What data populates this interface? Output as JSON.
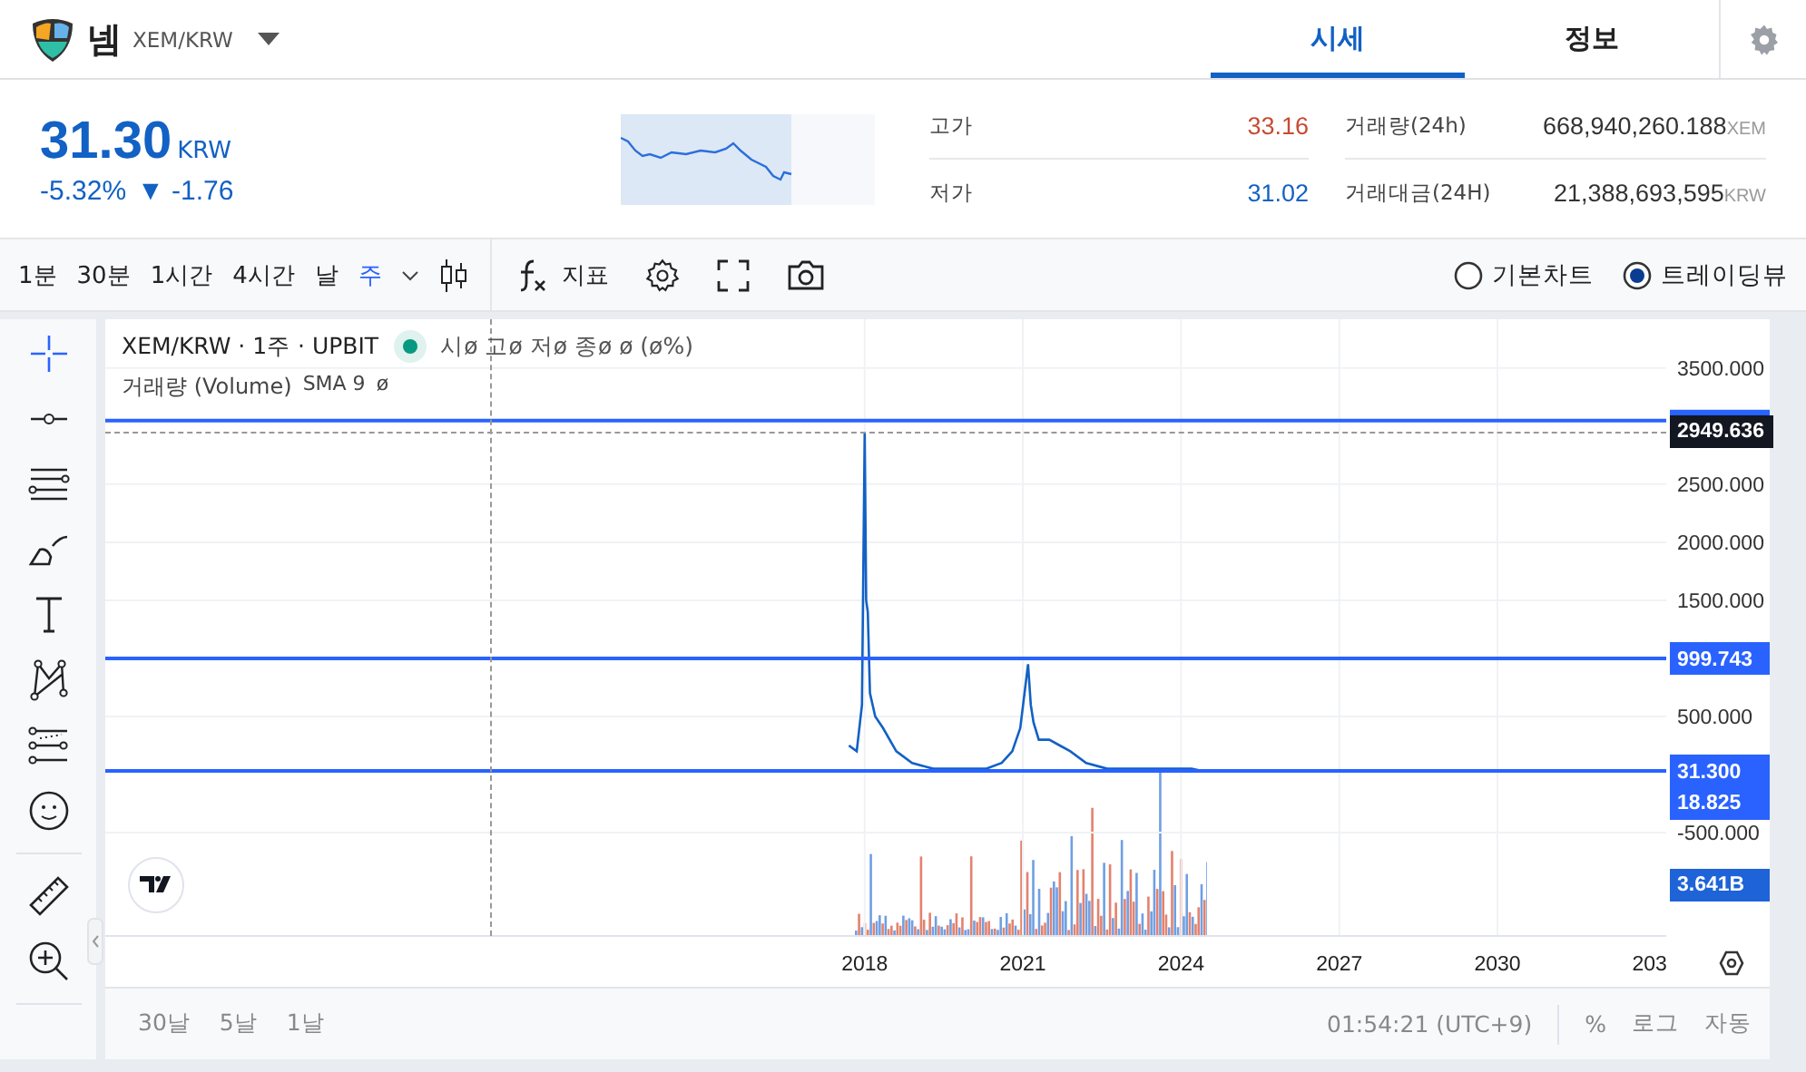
{
  "header": {
    "coin_name": "넴",
    "pair": "XEM/KRW",
    "tabs": [
      {
        "label": "시세",
        "selected": true
      },
      {
        "label": "정보",
        "selected": false
      }
    ]
  },
  "price": {
    "value": "31.30",
    "unit": "KRW",
    "color": "#1261c4",
    "change_percent": "-5.32%",
    "arrow": "▼",
    "change": "-1.76"
  },
  "stats": [
    {
      "label": "고가",
      "value": "33.16",
      "color": "#c84a31"
    },
    {
      "label": "저가",
      "value": "31.02",
      "color": "#1261c4"
    },
    {
      "label": "거래량(24h)",
      "value": "668,940,260.188",
      "unit": "XEM"
    },
    {
      "label": "거래대금(24H)",
      "value": "21,388,693,595",
      "unit": "KRW"
    }
  ],
  "toolbar": {
    "intervals": [
      {
        "label": "1분",
        "selected": false
      },
      {
        "label": "30분",
        "selected": false
      },
      {
        "label": "1시간",
        "selected": false
      },
      {
        "label": "4시간",
        "selected": false
      },
      {
        "label": "날",
        "selected": false
      },
      {
        "label": "주",
        "selected": true
      }
    ],
    "indicators_label": "지표",
    "chart_types": [
      {
        "label": "기본차트",
        "selected": false
      },
      {
        "label": "트레이딩뷰",
        "selected": true
      }
    ]
  },
  "tools": [
    {
      "kind": "crosshair",
      "selected": true
    },
    {
      "kind": "trendline",
      "selected": false
    },
    {
      "kind": "lines",
      "selected": false
    },
    {
      "kind": "brush",
      "selected": false
    },
    {
      "kind": "text",
      "selected": false
    },
    {
      "kind": "pattern",
      "selected": false
    },
    {
      "kind": "forecast",
      "selected": false
    },
    {
      "kind": "emoji",
      "selected": false
    },
    {
      "kind": "ruler",
      "selected": false
    },
    {
      "kind": "zoom",
      "selected": false
    }
  ],
  "legend": {
    "title": "XEM/KRW · 1주 · UPBIT",
    "ohlc": "시ø 고ø 저ø 종ø ø (ø%)",
    "volume_label": "거래량 (Volume)",
    "sma": "SMA 9",
    "sma_value": "ø"
  },
  "chart": {
    "chart_data": {
      "type": "line",
      "x": [
        2017.7,
        2017.85,
        2017.95,
        2018.0,
        2018.03,
        2018.06,
        2018.1,
        2018.2,
        2018.35,
        2018.6,
        2018.9,
        2019.3,
        2019.8,
        2020.3,
        2020.6,
        2020.8,
        2020.95,
        2021.1,
        2021.15,
        2021.2,
        2021.3,
        2021.5,
        2021.7,
        2021.9,
        2022.2,
        2022.6,
        2023.0,
        2023.5,
        2024.0,
        2024.2,
        2024.4
      ],
      "series": [
        {
          "color": "#1261c4",
          "values": [
            250,
            200,
            600,
            2950,
            1500,
            1400,
            700,
            500,
            400,
            200,
            100,
            50,
            50,
            50,
            100,
            200,
            400,
            950,
            600,
            450,
            300,
            300,
            250,
            200,
            100,
            50,
            50,
            50,
            50,
            50,
            31.3
          ]
        }
      ],
      "xlim": [
        2003.6,
        2033.2
      ],
      "ylim": [
        -1390,
        3920
      ],
      "grid": true,
      "xticks": [
        2018,
        2021,
        2024,
        2027,
        2030
      ],
      "yticks": [
        {
          "value": 3500,
          "label": "3500.000"
        },
        {
          "value": 2500,
          "label": "2500.000"
        },
        {
          "value": 2000,
          "label": "2000.000"
        },
        {
          "value": 1500,
          "label": "1500.000"
        },
        {
          "value": 500,
          "label": "500.000"
        },
        {
          "value": -500,
          "label": "-500.000"
        }
      ],
      "ref_lines": [
        {
          "axis": "y",
          "value": 3047
        },
        {
          "axis": "y",
          "value": 999.743,
          "label": "999.743"
        },
        {
          "axis": "y",
          "value": 31.3,
          "label": "31.300"
        }
      ]
    },
    "cut_xtick_label": "203",
    "crosshair_label": "2949.636",
    "tags": [
      {
        "kind": "sma",
        "text": "18.825"
      },
      {
        "kind": "volume",
        "text": "3.641B"
      }
    ]
  },
  "footer": {
    "ranges": [
      "30날",
      "5날",
      "1날"
    ],
    "clock": "01:54:21 (UTC+9)",
    "scale_options": [
      "%",
      "로그",
      "자동"
    ]
  }
}
